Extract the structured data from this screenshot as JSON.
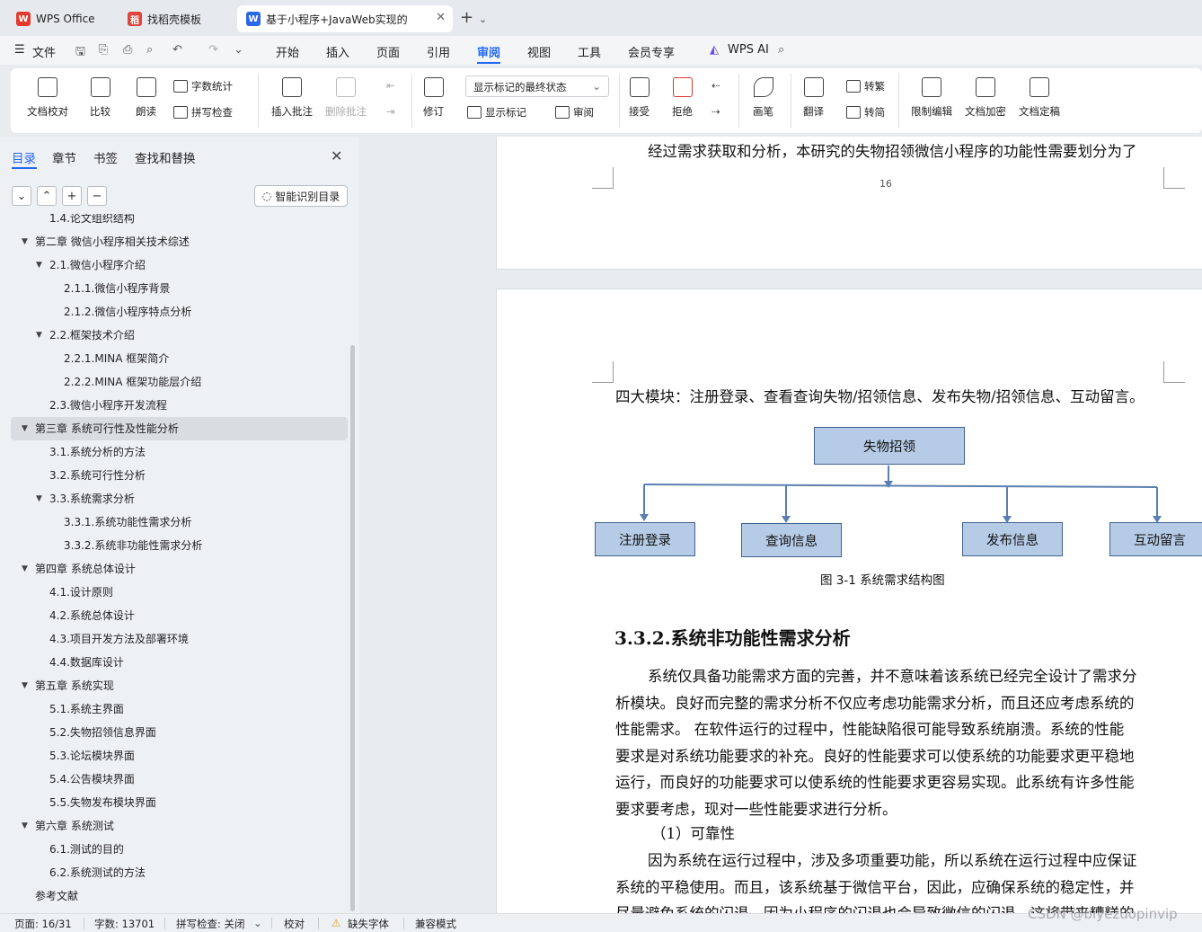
{
  "tabs": [
    {
      "label": "WPS Office"
    },
    {
      "label": "找稻壳模板"
    },
    {
      "label": "基于小程序+JavaWeb实现的"
    }
  ],
  "menu": {
    "file": "文件",
    "items": [
      "开始",
      "插入",
      "页面",
      "引用",
      "审阅",
      "视图",
      "工具",
      "会员专享"
    ],
    "active": "审阅",
    "ai": "WPS AI"
  },
  "ribbon": {
    "doc_check": "文档校对",
    "compare": "比较",
    "read_aloud": "朗读",
    "word_count": "字数统计",
    "spell_check": "拼写检查",
    "insert_comment": "插入批注",
    "delete_comment": "删除批注",
    "revise": "修订",
    "markup_state": "显示标记的最终状态",
    "show_markup": "显示标记",
    "review": "审阅",
    "accept": "接受",
    "reject": "拒绝",
    "pen": "画笔",
    "translate": "翻译",
    "to_traditional": "转繁",
    "to_simplified": "转简",
    "restrict_edit": "限制编辑",
    "encrypt": "文档加密",
    "finalize": "文档定稿"
  },
  "panel": {
    "tabs": [
      "目录",
      "章节",
      "书签",
      "查找和替换"
    ],
    "smart_btn": "智能识别目录",
    "toc": [
      {
        "label": "1.4.论文组织结构",
        "level": 2
      },
      {
        "label": "第二章  微信小程序相关技术综述",
        "level": 1
      },
      {
        "label": "2.1.微信小程序介绍",
        "level": 2
      },
      {
        "label": "2.1.1.微信小程序背景",
        "level": 3
      },
      {
        "label": "2.1.2.微信小程序特点分析",
        "level": 3
      },
      {
        "label": "2.2.框架技术介绍",
        "level": 2
      },
      {
        "label": "2.2.1.MINA 框架简介",
        "level": 3
      },
      {
        "label": "2.2.2.MINA 框架功能层介绍",
        "level": 3
      },
      {
        "label": "2.3.微信小程序开发流程",
        "level": 2
      },
      {
        "label": "第三章  系统可行性及性能分析",
        "level": 1
      },
      {
        "label": "3.1.系统分析的方法",
        "level": 2
      },
      {
        "label": "3.2.系统可行性分析",
        "level": 2
      },
      {
        "label": "3.3.系统需求分析",
        "level": 2
      },
      {
        "label": "3.3.1.系统功能性需求分析",
        "level": 3
      },
      {
        "label": "3.3.2.系统非功能性需求分析",
        "level": 3
      },
      {
        "label": "第四章  系统总体设计",
        "level": 1
      },
      {
        "label": "4.1.设计原则",
        "level": 2
      },
      {
        "label": "4.2.系统总体设计",
        "level": 2
      },
      {
        "label": "4.3.项目开发方法及部署环境",
        "level": 2
      },
      {
        "label": "4.4.数据库设计",
        "level": 2
      },
      {
        "label": "第五章  系统实现",
        "level": 1
      },
      {
        "label": "5.1.系统主界面",
        "level": 2
      },
      {
        "label": "5.2.失物招领信息界面",
        "level": 2
      },
      {
        "label": "5.3.论坛模块界面",
        "level": 2
      },
      {
        "label": "5.4.公告模块界面",
        "level": 2
      },
      {
        "label": "5.5.失物发布模块界面",
        "level": 2
      },
      {
        "label": "第六章  系统测试",
        "level": 1
      },
      {
        "label": "6.1.测试的目的",
        "level": 2
      },
      {
        "label": "6.2.系统测试的方法",
        "level": 2
      },
      {
        "label": "参考文献",
        "level": 1
      }
    ],
    "selected_index": 9
  },
  "document": {
    "prev_page_line": "经过需求获取和分析，本研究的失物招领微信小程序的功能性需要划分为了",
    "page_number": "16",
    "modules_line": "四大模块：注册登录、查看查询失物/招领信息、发布失物/招领信息、互动留言。",
    "diagram": {
      "root": "失物招领",
      "children": [
        "注册登录",
        "查询信息",
        "发布信息",
        "互动留言"
      ]
    },
    "figure_caption": "图 3-1  系统需求结构图",
    "section_heading": "3.3.2.系统非功能性需求分析",
    "para1": [
      "系统仅具备功能需求方面的完善，并不意味着该系统已经完全设计了需求分",
      "析模块。良好而完整的需求分析不仅应考虑功能需求分析，而且还应考虑系统的",
      "性能需求。  在软件运行的过程中，性能缺陷很可能导致系统崩溃。系统的性能",
      "要求是对系统功能要求的补充。良好的性能要求可以使系统的功能要求更平稳地",
      "运行，而良好的功能要求可以使系统的性能要求更容易实现。此系统有许多性能",
      "要求要考虑，现对一些性能要求进行分析。"
    ],
    "sub_heading": "（1）可靠性",
    "para2": [
      "因为系统在运行过程中，涉及多项重要功能，所以系统在运行过程中应保证",
      "系统的平稳使用。而且，该系统基于微信平台，因此，应确保系统的稳定性，并",
      "尽量避免系统的闪退，因为小程序的闪退也会导致微信的闪退，这将带来糟糕的"
    ]
  },
  "status": {
    "page": "页面: 16/31",
    "words": "字数: 13701",
    "spell": "拼写检查: 关闭",
    "proof": "校对",
    "missing_font": "缺失字体",
    "compat": "兼容模式"
  },
  "watermark": "CSDN @biyezuopinvip"
}
